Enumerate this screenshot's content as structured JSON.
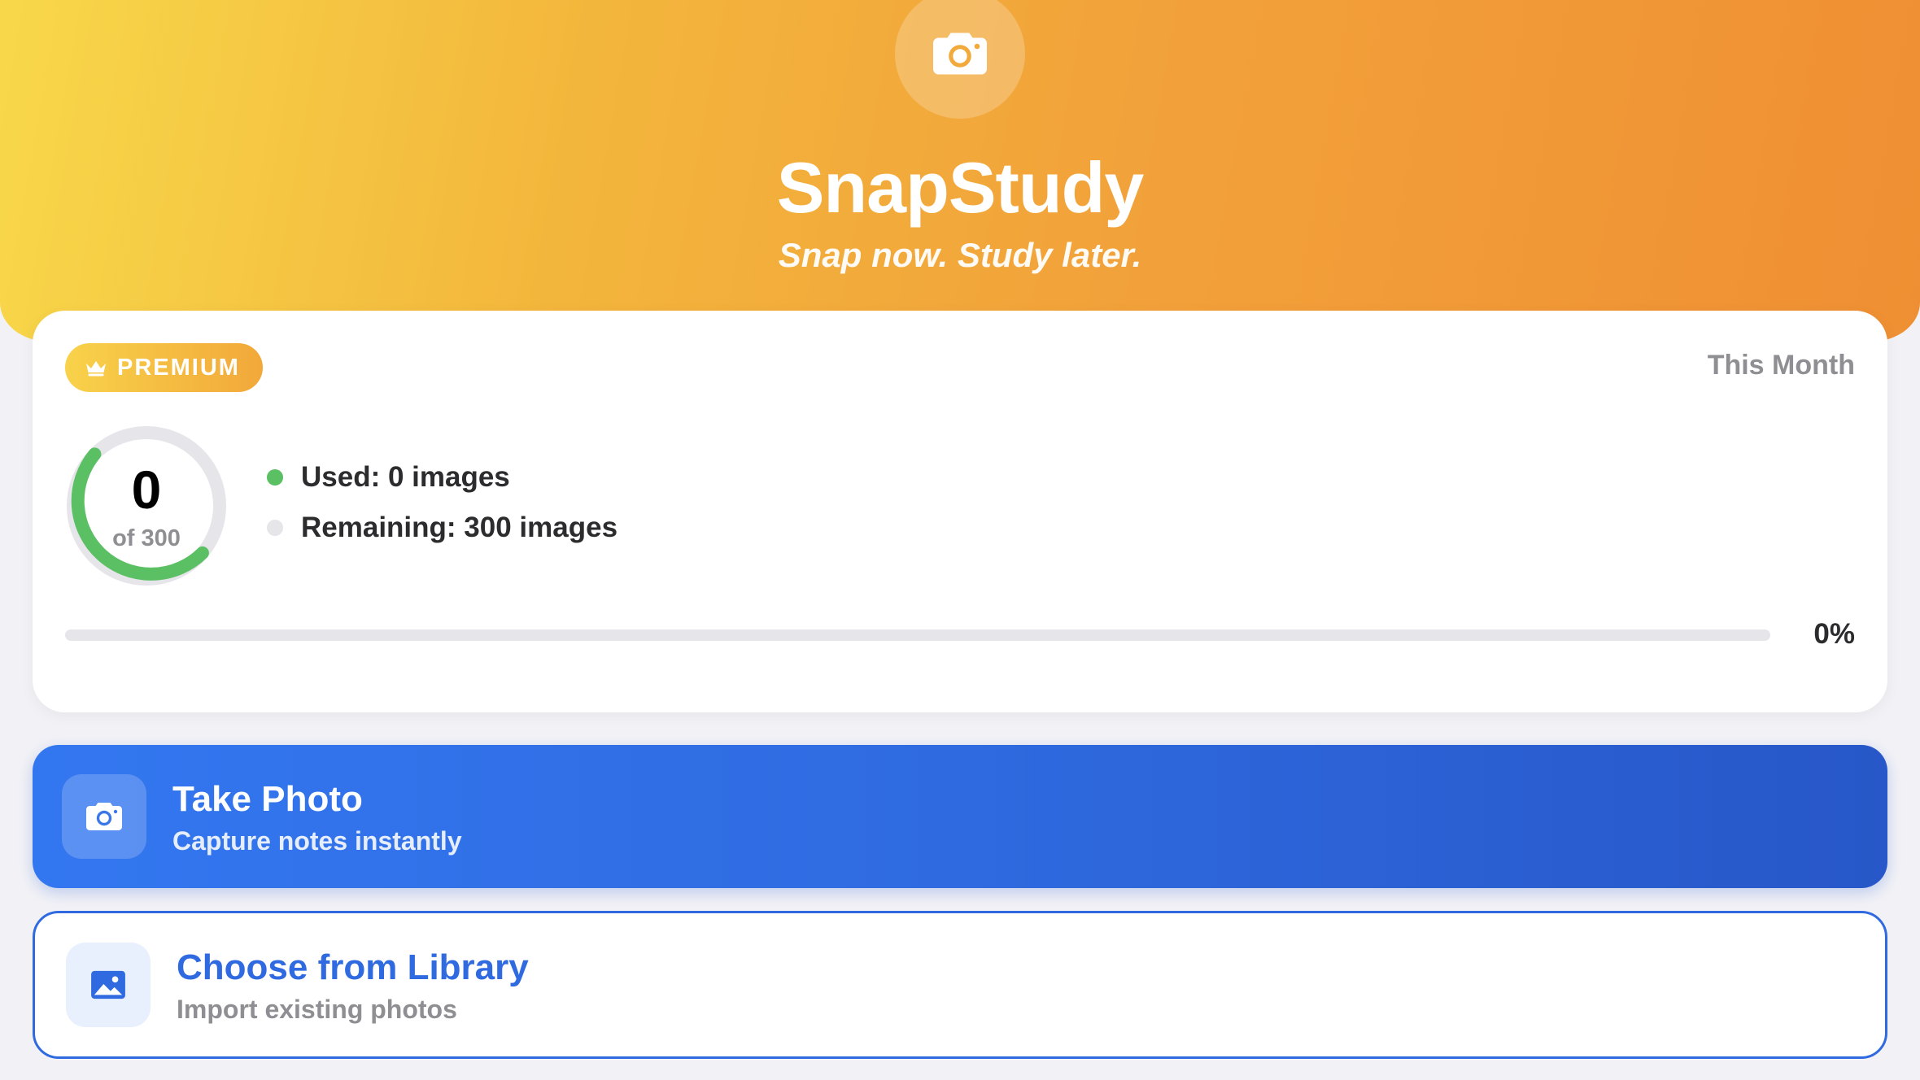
{
  "header": {
    "icon": "camera-icon",
    "title": "SnapStudy",
    "tagline": "Snap now. Study later.",
    "gradient_colors": [
      "#f8d84a",
      "#f3b63c",
      "#f2a13a",
      "#ef8f33"
    ]
  },
  "usage": {
    "badge_icon": "crown-icon",
    "badge_label": "PREMIUM",
    "period_label": "This Month",
    "used_count": "0",
    "total_label": "of 300",
    "used": 0,
    "limit": 300,
    "used_legend": "Used: 0 images",
    "remaining_legend": "Remaining: 300 images",
    "progress_percent_label": "0%",
    "progress_fraction": 0,
    "used_color": "#5bbf63",
    "remaining_color": "#e5e5ea"
  },
  "actions": {
    "take_photo": {
      "icon": "camera-icon",
      "title": "Take Photo",
      "subtitle": "Capture notes instantly",
      "color": "#2f6ae0"
    },
    "choose_library": {
      "icon": "image-icon",
      "title": "Choose from Library",
      "subtitle": "Import existing photos",
      "color": "#2f6ae0"
    }
  }
}
